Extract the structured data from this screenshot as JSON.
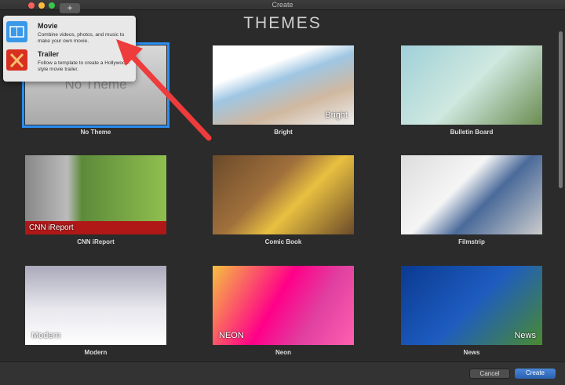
{
  "window": {
    "title": "Create",
    "add_label": "+"
  },
  "heading": "THEMES",
  "themes": [
    {
      "label": "No Theme",
      "caption": "No Theme",
      "bg": "linear-gradient(#d8d8d8,#a9a9a9)",
      "selected": true
    },
    {
      "label": "Bright",
      "caption": "Bright",
      "bg": "linear-gradient(160deg,#fff 30%,#9fc6e3 45%,#d0b8a0 70%,#eee)"
    },
    {
      "label": "Bulletin Board",
      "caption": "",
      "bg": "linear-gradient(135deg,#9fd0d8,#cfe8e0 50%,#6b8c50)"
    },
    {
      "label": "CNN iReport",
      "caption": "CNN iReport",
      "bg": "linear-gradient(90deg,#888 0,#bbb 30%,#5d8a3a 40%,#8fbf4f)"
    },
    {
      "label": "Comic Book",
      "caption": "",
      "bg": "linear-gradient(135deg,#6b4a2a,#a0703c 40%,#e8c040 60%,#6b4a2a)"
    },
    {
      "label": "Filmstrip",
      "caption": "",
      "bg": "linear-gradient(135deg,#ddd,#f5f5f5 40%,#4a6a9a 60%,#ccc)"
    },
    {
      "label": "Modern",
      "caption": "Modern",
      "bg": "linear-gradient(180deg,#aab 0,#e8e8ee 55%,#fff)"
    },
    {
      "label": "Neon",
      "caption": "NEON",
      "bg": "linear-gradient(120deg,#f6c040 0,#f08 45%,#e040a0 70%,#ff60b0)"
    },
    {
      "label": "News",
      "caption": "News",
      "bg": "linear-gradient(135deg,#0a3a90,#1e5cc0 50%,#4a8a30)"
    }
  ],
  "popover": {
    "items": [
      {
        "title": "Movie",
        "desc": "Combine videos, photos, and music to make your own movie.",
        "icon": "film-icon",
        "color": "#3a98e8"
      },
      {
        "title": "Trailer",
        "desc": "Follow a template to create a Hollywood-style movie trailer.",
        "icon": "trailer-icon",
        "color": "#d83020"
      }
    ]
  },
  "footer": {
    "cancel": "Cancel",
    "create": "Create"
  },
  "colors": {
    "accent": "#2a8ef0",
    "arrow": "#ee3b3b"
  }
}
